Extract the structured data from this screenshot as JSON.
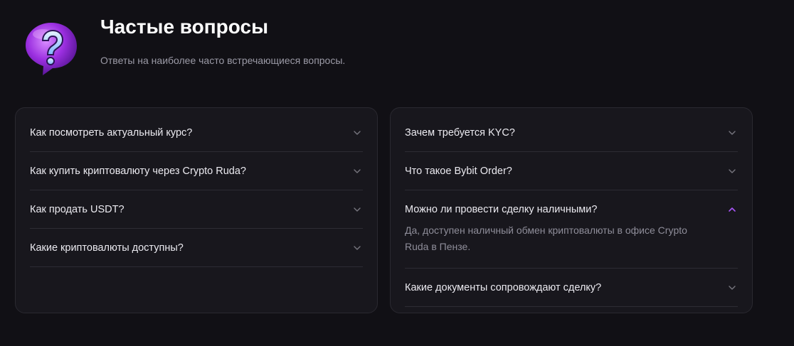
{
  "header": {
    "title": "Частые вопросы",
    "subtitle": "Ответы на наиболее часто встречающиеся вопросы.",
    "icon": "question-bubble-icon"
  },
  "colors": {
    "background": "#111015",
    "card": "#18171d",
    "accent": "#a855f7",
    "muted_text": "#9b9aa6"
  },
  "faq_left": [
    {
      "question": "Как посмотреть актуальный курс?",
      "open": false
    },
    {
      "question": "Как купить криптовалюту через Crypto Ruda?",
      "open": false
    },
    {
      "question": "Как продать USDT?",
      "open": false
    },
    {
      "question": "Какие криптовалюты доступны?",
      "open": false
    }
  ],
  "faq_right": [
    {
      "question": "Зачем требуется KYC?",
      "open": false
    },
    {
      "question": "Что такое Bybit Order?",
      "open": false
    },
    {
      "question": "Можно ли провести сделку наличными?",
      "open": true,
      "answer": "Да, доступен наличный обмен криптовалюты в офисе Crypto Ruda в Пензе."
    },
    {
      "question": "Какие документы сопровождают сделку?",
      "open": false
    }
  ]
}
